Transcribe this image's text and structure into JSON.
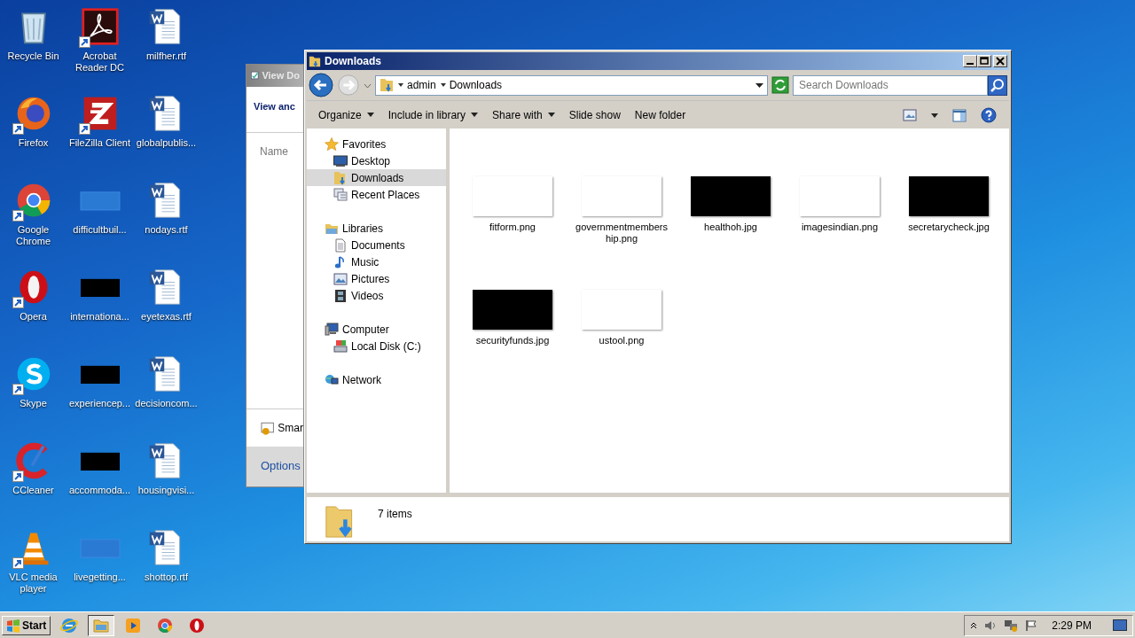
{
  "desktop": {
    "icons": [
      {
        "label": "Recycle Bin",
        "kind": "recycle",
        "shortcut": false
      },
      {
        "label": "Firefox",
        "kind": "firefox",
        "shortcut": true
      },
      {
        "label": "Google Chrome",
        "kind": "chrome",
        "shortcut": true
      },
      {
        "label": "Opera",
        "kind": "opera",
        "shortcut": true
      },
      {
        "label": "Skype",
        "kind": "skype",
        "shortcut": true
      },
      {
        "label": "CCleaner",
        "kind": "ccleaner",
        "shortcut": true
      },
      {
        "label": "VLC media player",
        "kind": "vlc",
        "shortcut": true
      },
      {
        "label": "Acrobat Reader DC",
        "kind": "acrobat",
        "shortcut": true
      },
      {
        "label": "FileZilla Client",
        "kind": "filezilla",
        "shortcut": true
      },
      {
        "label": "difficultbuil...",
        "kind": "blank",
        "shortcut": false
      },
      {
        "label": "internationa...",
        "kind": "dark",
        "shortcut": false
      },
      {
        "label": "experiencep...",
        "kind": "dark",
        "shortcut": false
      },
      {
        "label": "accommoda...",
        "kind": "dark",
        "shortcut": false
      },
      {
        "label": "livegetting...",
        "kind": "blank",
        "shortcut": false
      },
      {
        "label": "milfher.rtf",
        "kind": "word",
        "shortcut": false
      },
      {
        "label": "globalpublis...",
        "kind": "word",
        "shortcut": false
      },
      {
        "label": "nodays.rtf",
        "kind": "word",
        "shortcut": false
      },
      {
        "label": "eyetexas.rtf",
        "kind": "word",
        "shortcut": false
      },
      {
        "label": "decisioncom...",
        "kind": "word",
        "shortcut": false
      },
      {
        "label": "housingvisi...",
        "kind": "word",
        "shortcut": false
      },
      {
        "label": "shottop.rtf",
        "kind": "word",
        "shortcut": false
      }
    ]
  },
  "back_window": {
    "title": "View Do",
    "heading": "View anc",
    "column": "Name",
    "item": "Smar",
    "button": "Options"
  },
  "explorer": {
    "title": "Downloads",
    "breadcrumb": [
      "admin",
      "Downloads"
    ],
    "search": {
      "placeholder": "Search Downloads"
    },
    "toolbar": [
      {
        "label": "Organize",
        "dropdown": true
      },
      {
        "label": "Include in library",
        "dropdown": true
      },
      {
        "label": "Share with",
        "dropdown": true
      },
      {
        "label": "Slide show",
        "dropdown": false
      },
      {
        "label": "New folder",
        "dropdown": false
      }
    ],
    "nav": [
      {
        "label": "Favorites",
        "kind": "star",
        "selected": false,
        "children": [
          {
            "label": "Desktop",
            "kind": "desktop",
            "selected": false
          },
          {
            "label": "Downloads",
            "kind": "downloads",
            "selected": true
          },
          {
            "label": "Recent Places",
            "kind": "recent",
            "selected": false
          }
        ]
      },
      {
        "label": "Libraries",
        "kind": "library",
        "selected": false,
        "children": [
          {
            "label": "Documents",
            "kind": "document",
            "selected": false
          },
          {
            "label": "Music",
            "kind": "music",
            "selected": false
          },
          {
            "label": "Pictures",
            "kind": "pictures",
            "selected": false
          },
          {
            "label": "Videos",
            "kind": "videos",
            "selected": false
          }
        ]
      },
      {
        "label": "Computer",
        "kind": "computer",
        "selected": false,
        "children": [
          {
            "label": "Local Disk (C:)",
            "kind": "disk",
            "selected": false
          }
        ]
      },
      {
        "label": "Network",
        "kind": "network",
        "selected": false
      }
    ],
    "files": [
      {
        "name": "fitform.png",
        "kind": "light"
      },
      {
        "name": "governmentmembership.png",
        "kind": "light"
      },
      {
        "name": "healthoh.jpg",
        "kind": "dark"
      },
      {
        "name": "imagesindian.png",
        "kind": "light"
      },
      {
        "name": "secretarycheck.jpg",
        "kind": "dark"
      },
      {
        "name": "securityfunds.jpg",
        "kind": "dark"
      },
      {
        "name": "ustool.png",
        "kind": "light"
      }
    ],
    "status": "7 items"
  },
  "taskbar": {
    "start": "Start",
    "apps": [
      {
        "kind": "ie",
        "active": false
      },
      {
        "kind": "explorer",
        "active": true
      },
      {
        "kind": "media",
        "active": false
      },
      {
        "kind": "chrome",
        "active": false
      },
      {
        "kind": "opera",
        "active": false
      }
    ],
    "clock": "2:29 PM"
  }
}
